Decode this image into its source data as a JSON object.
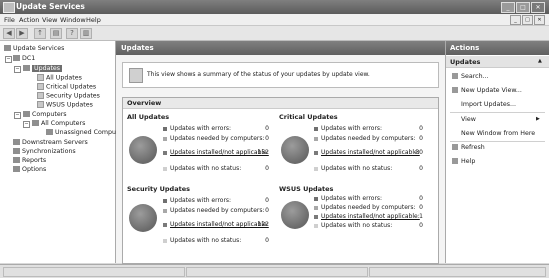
{
  "window": {
    "title": "Update Services"
  },
  "menu": [
    "File",
    "Action",
    "View",
    "Window",
    "Help"
  ],
  "toolbar": {
    "icons": [
      "back-icon",
      "forward-icon",
      "up-icon",
      "properties-icon",
      "help-icon",
      "show-hide-icon"
    ]
  },
  "tree": {
    "root": "Update Services",
    "server": "DC1",
    "updates": "Updates",
    "all_updates": "All Updates",
    "critical_updates": "Critical Updates",
    "security_updates": "Security Updates",
    "wsus_updates": "WSUS Updates",
    "computers": "Computers",
    "all_computers": "All Computers",
    "unassigned": "Unassigned Compu",
    "downstream": "Downstream Servers",
    "synchronizations": "Synchronizations",
    "reports": "Reports",
    "options": "Options"
  },
  "center": {
    "header": "Updates",
    "info_text": "This view shows a summary of the status of your updates by update view.",
    "overview_title": "Overview",
    "sections": [
      {
        "title": "All Updates",
        "rows": [
          {
            "label": "Updates with errors:",
            "value": "0"
          },
          {
            "label": "Updates needed by computers:",
            "value": "0"
          },
          {
            "label": "Updates installed/not applicable:",
            "value": "152"
          },
          {
            "label": "Updates with no status:",
            "value": "0"
          }
        ]
      },
      {
        "title": "Critical Updates",
        "rows": [
          {
            "label": "Updates with errors:",
            "value": "0"
          },
          {
            "label": "Updates needed by computers:",
            "value": "0"
          },
          {
            "label": "Updates installed/not applicable:",
            "value": "30"
          },
          {
            "label": "Updates with no status:",
            "value": "0"
          }
        ]
      },
      {
        "title": "Security Updates",
        "rows": [
          {
            "label": "Updates with errors:",
            "value": "0"
          },
          {
            "label": "Updates needed by computers:",
            "value": "0"
          },
          {
            "label": "Updates installed/not applicable:",
            "value": "122"
          },
          {
            "label": "Updates with no status:",
            "value": "0"
          }
        ]
      },
      {
        "title": "WSUS Updates",
        "rows": [
          {
            "label": "Updates with errors:",
            "value": "0"
          },
          {
            "label": "Updates needed by computers:",
            "value": "0"
          },
          {
            "label": "Updates installed/not applicable:",
            "value": "1"
          },
          {
            "label": "Updates with no status:",
            "value": "0"
          }
        ]
      }
    ]
  },
  "actions": {
    "header": "Actions",
    "group": "Updates",
    "items": [
      "Search...",
      "New Update View...",
      "Import Updates...",
      "View",
      "New Window from Here",
      "Refresh",
      "Help"
    ]
  },
  "colors": {
    "header_bg": "#707070",
    "selection": "#6e6e6e"
  }
}
